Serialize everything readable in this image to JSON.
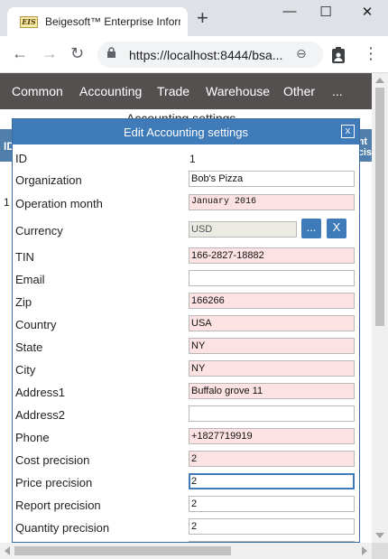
{
  "browser": {
    "tab_title": "Beigesoft™ Enterprise Information",
    "favicon_text": "EIS",
    "url": "https://localhost:8444/bsa...",
    "new_tab": "+",
    "back": "←",
    "forward": "→",
    "reload": "↻",
    "minimize": "—",
    "maximize": "☐",
    "close": "✕",
    "more": "⋮",
    "zoom": "⊖"
  },
  "nav": {
    "items": [
      "Common",
      "Accounting",
      "Trade",
      "Warehouse",
      "Other",
      "..."
    ]
  },
  "page": {
    "title": "Accounting settings",
    "th_left": "ID",
    "th_right_1": "nt",
    "th_right_2": "cis",
    "row_num": "1"
  },
  "dialog": {
    "title": "Edit Accounting settings",
    "close_label": "x",
    "fields": {
      "id": {
        "label": "ID",
        "value": "1"
      },
      "organization": {
        "label": "Organization",
        "value": "Bob's Pizza"
      },
      "operation_month": {
        "label": "Operation month",
        "value": "January 2016"
      },
      "currency": {
        "label": "Currency",
        "value": "USD",
        "pick_label": "...",
        "clear_label": "X"
      },
      "tin": {
        "label": "TIN",
        "value": "166-2827-18882"
      },
      "email": {
        "label": "Email",
        "value": ""
      },
      "zip": {
        "label": "Zip",
        "value": "166266"
      },
      "country": {
        "label": "Country",
        "value": "USA"
      },
      "state": {
        "label": "State",
        "value": "NY"
      },
      "city": {
        "label": "City",
        "value": "NY"
      },
      "address1": {
        "label": "Address1",
        "value": "Buffalo grove 11"
      },
      "address2": {
        "label": "Address2",
        "value": ""
      },
      "phone": {
        "label": "Phone",
        "value": "+1827719919"
      },
      "cost_precision": {
        "label": "Cost precision",
        "value": "2"
      },
      "price_precision": {
        "label": "Price precision",
        "value": "2"
      },
      "report_precision": {
        "label": "Report precision",
        "value": "2"
      },
      "quantity_precision": {
        "label": "Quantity precision",
        "value": "2"
      }
    }
  }
}
